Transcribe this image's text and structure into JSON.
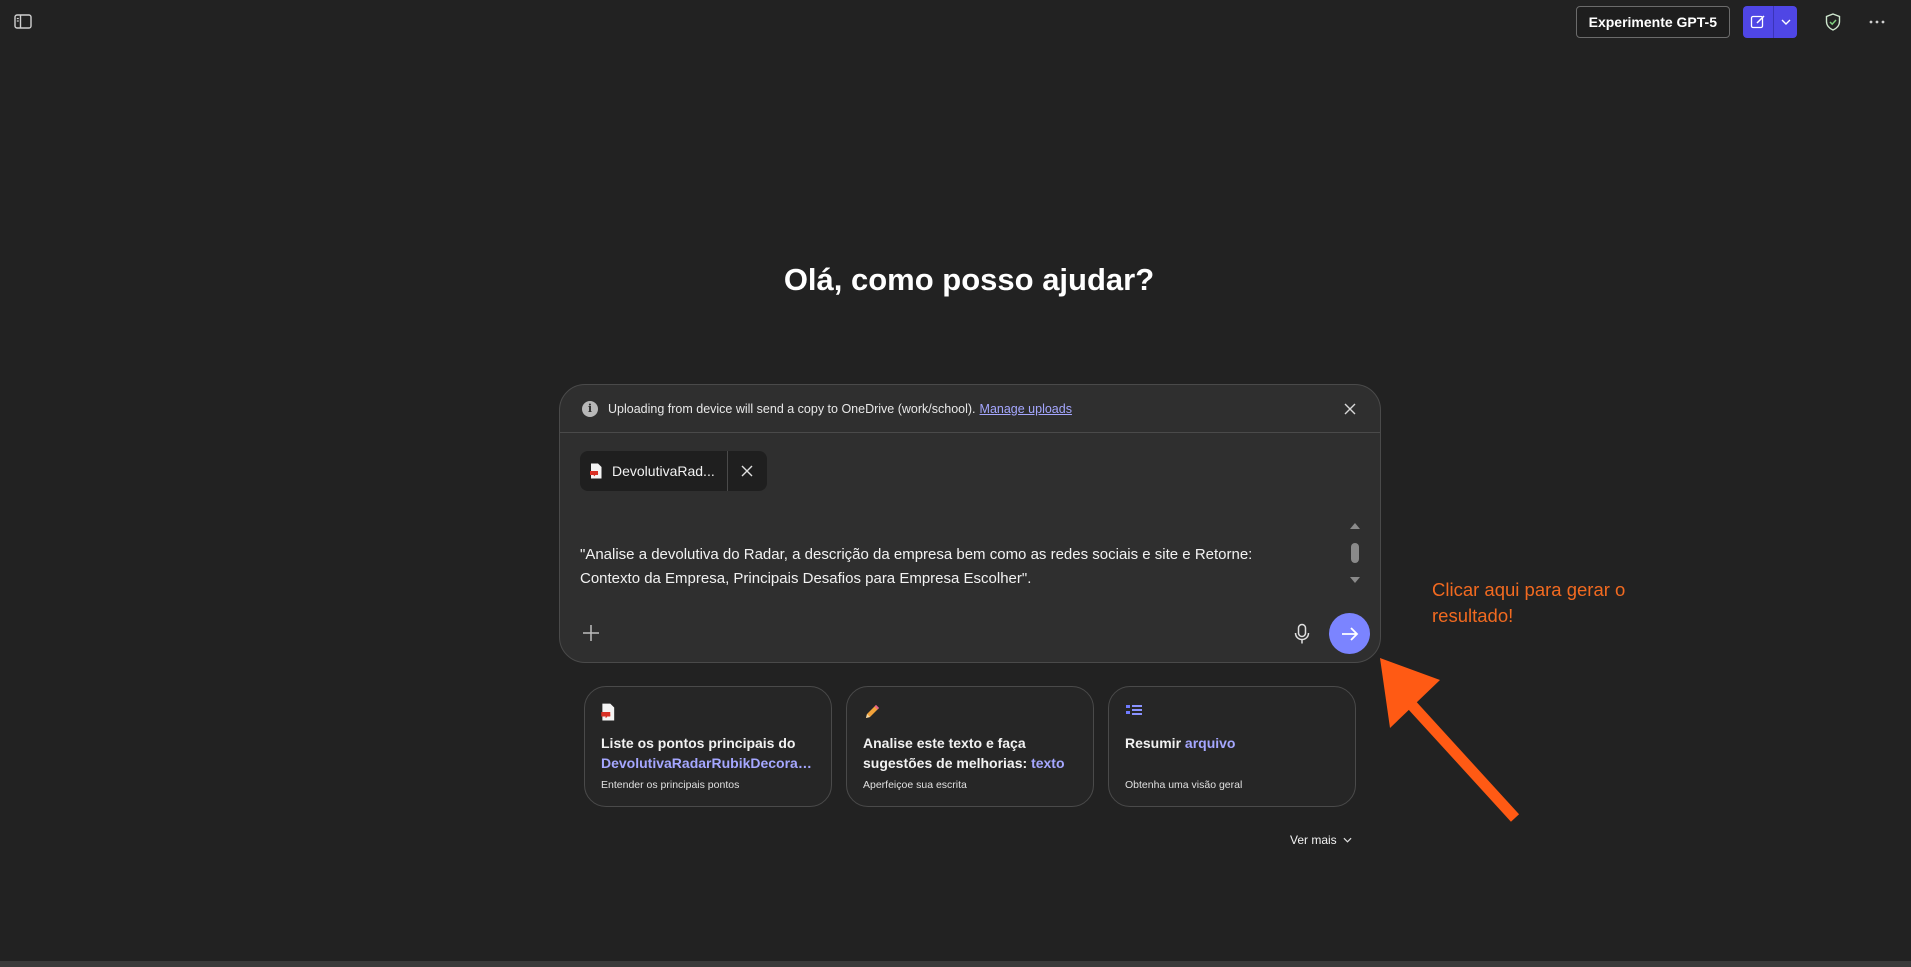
{
  "header": {
    "gpt5_label": "Experimente GPT-5"
  },
  "greeting": "Olá, como posso ajudar?",
  "composer": {
    "notice_text": "Uploading from device will send a copy to OneDrive (work/school).",
    "notice_link": "Manage uploads",
    "attachment_name": "DevolutivaRad...",
    "prompt_line1": "\"Analise a devolutiva do Radar, a descrição da empresa bem como as redes sociais e site e Retorne:",
    "prompt_line2": "Contexto da Empresa, Principais Desafios para Empresa Escolher\"."
  },
  "suggestions": [
    {
      "title_prefix": "Liste os pontos principais do",
      "title_highlight": "DevolutivaRadarRubikDecoraçõ...",
      "subtitle": "Entender os principais pontos",
      "icon": "pdf-file-icon"
    },
    {
      "title_prefix": "Analise este texto e faça sugestões de melhorias:",
      "title_highlight": "texto",
      "subtitle": "Aperfeiçoe sua escrita",
      "icon": "pencil-icon"
    },
    {
      "title_prefix": "Resumir",
      "title_highlight": "arquivo",
      "subtitle": "Obtenha uma visão geral",
      "icon": "list-icon"
    }
  ],
  "see_more": "Ver mais",
  "annotation": {
    "text_line1": "Clicar aqui para gerar o",
    "text_line2": "resultado!",
    "color": "#f26a20"
  },
  "colors": {
    "background": "#222222",
    "accent": "#4f46e5",
    "send_button": "#7b84ff",
    "link": "#a5a7ff"
  }
}
